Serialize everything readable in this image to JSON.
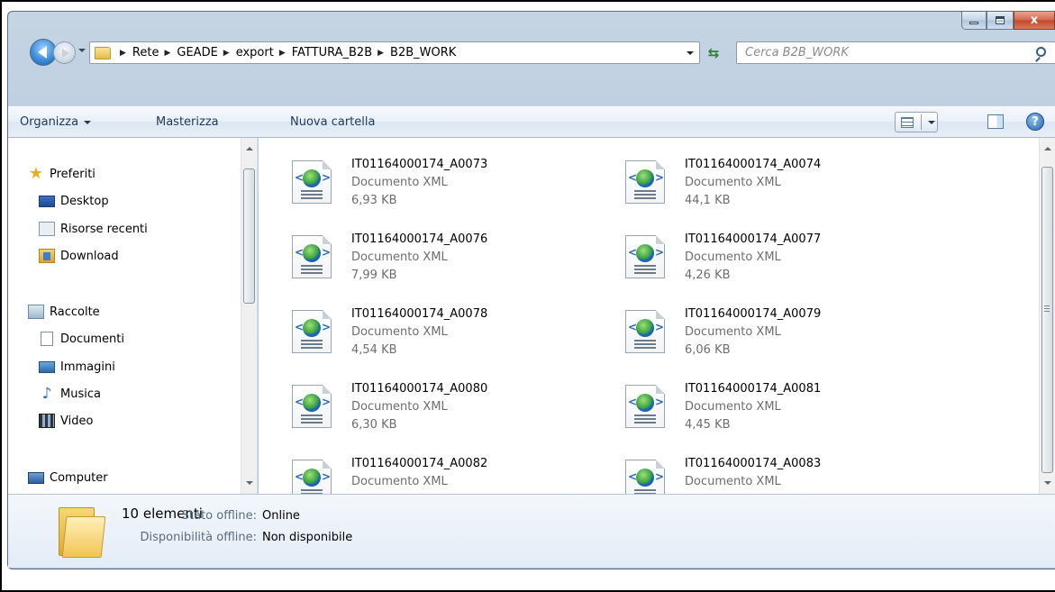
{
  "window": {
    "close_glyph": "x"
  },
  "address": {
    "breadcrumbs": [
      "Rete",
      "GEADE",
      "export",
      "FATTURA_B2B",
      "B2B_WORK"
    ],
    "search_placeholder": "Cerca B2B_WORK"
  },
  "toolbar": {
    "organize": "Organizza",
    "burn": "Masterizza",
    "new_folder": "Nuova cartella",
    "help_glyph": "?"
  },
  "nav": {
    "favorites": "Preferiti",
    "desktop": "Desktop",
    "recent": "Risorse recenti",
    "downloads": "Download",
    "libraries": "Raccolte",
    "documents": "Documenti",
    "pictures": "Immagini",
    "music": "Musica",
    "videos": "Video",
    "computer": "Computer"
  },
  "files": [
    {
      "name": "IT01164000174_A0073",
      "type": "Documento XML",
      "size": "6,93 KB"
    },
    {
      "name": "IT01164000174_A0074",
      "type": "Documento XML",
      "size": "44,1 KB"
    },
    {
      "name": "IT01164000174_A0076",
      "type": "Documento XML",
      "size": "7,99 KB"
    },
    {
      "name": "IT01164000174_A0077",
      "type": "Documento XML",
      "size": "4,26 KB"
    },
    {
      "name": "IT01164000174_A0078",
      "type": "Documento XML",
      "size": "4,54 KB"
    },
    {
      "name": "IT01164000174_A0079",
      "type": "Documento XML",
      "size": "6,06 KB"
    },
    {
      "name": "IT01164000174_A0080",
      "type": "Documento XML",
      "size": "6,30 KB"
    },
    {
      "name": "IT01164000174_A0081",
      "type": "Documento XML",
      "size": "4,45 KB"
    },
    {
      "name": "IT01164000174_A0082",
      "type": "Documento XML",
      "size": ""
    },
    {
      "name": "IT01164000174_A0083",
      "type": "Documento XML",
      "size": ""
    }
  ],
  "details": {
    "count": "10 elementi",
    "offline_status_label": "Stato offline:",
    "offline_status_value": "Online",
    "offline_availability_label": "Disponibilità offline:",
    "offline_availability_value": "Non disponibile"
  }
}
